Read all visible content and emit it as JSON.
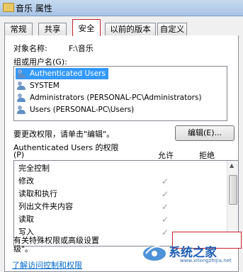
{
  "window": {
    "title": "音乐 属性"
  },
  "tabs": [
    {
      "label": "常规"
    },
    {
      "label": "共享"
    },
    {
      "label": "安全"
    },
    {
      "label": "以前的版本"
    },
    {
      "label": "自定义"
    }
  ],
  "object": {
    "label": "对象名称:",
    "value": "F:\\音乐"
  },
  "group": {
    "label": "组或用户名(G):",
    "users": [
      "Authenticated Users",
      "SYSTEM",
      "Administrators (PERSONAL-PC\\Administrators)",
      "Users (PERSONAL-PC\\Users)"
    ]
  },
  "edit": {
    "hint": "要更改权限，请单击\"编辑\"。",
    "button": "编辑(E)..."
  },
  "permissions": {
    "title_line1": "Authenticated Users 的权限",
    "title_line2": "(P)",
    "allow_header": "允许",
    "deny_header": "拒绝",
    "check_mark": "✓",
    "rows": [
      {
        "name": "完全控制",
        "allow": false
      },
      {
        "name": "修改",
        "allow": true
      },
      {
        "name": "读取和执行",
        "allow": true
      },
      {
        "name": "列出文件夹内容",
        "allow": true
      },
      {
        "name": "读取",
        "allow": true
      },
      {
        "name": "写入",
        "allow": true
      }
    ]
  },
  "advanced": {
    "hint_line1": "有关特殊权限或高级设置",
    "hint_line2": "级\"。"
  },
  "link": "了解访问控制和权限",
  "watermark": {
    "text": "系统之家",
    "url": "www.xitongzhijia.net"
  },
  "colors": {
    "selection": "#3399ff",
    "highlight_border": "#c9232d",
    "link": "#0066cc"
  }
}
